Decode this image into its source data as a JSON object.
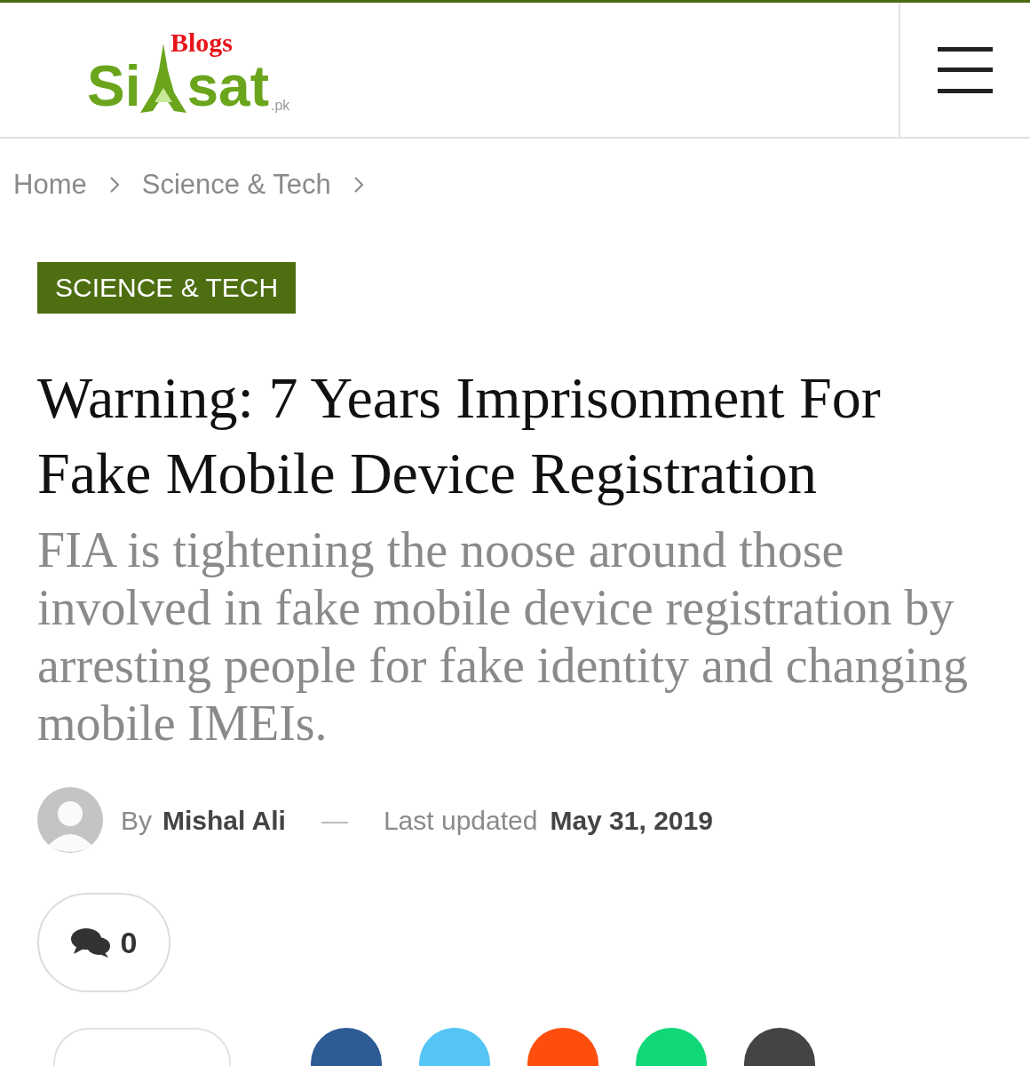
{
  "logo": {
    "part_1": "Si",
    "part_2": "sat",
    "badge": "Blogs",
    "suffix": ".pk"
  },
  "breadcrumb": [
    {
      "label": "Home"
    },
    {
      "label": "Science & Tech"
    }
  ],
  "category": "SCIENCE & TECH",
  "title": "Warning: 7 Years Imprisonment For Fake Mobile Device Registration",
  "subtitle": "FIA is tightening the noose around those involved in fake mobile device registration by arresting people for fake identity and changing mobile IMEIs.",
  "meta": {
    "by": "By",
    "author": "Mishal Ali",
    "separator": "—",
    "updated_label": "Last updated",
    "date": "May 31, 2019"
  },
  "comments": {
    "count": "0"
  },
  "share_buttons": [
    {
      "color": "#2d5b95"
    },
    {
      "color": "#55c5f5"
    },
    {
      "color": "#fe4e0d"
    },
    {
      "color": "#10d878"
    },
    {
      "color": "#444444"
    }
  ]
}
